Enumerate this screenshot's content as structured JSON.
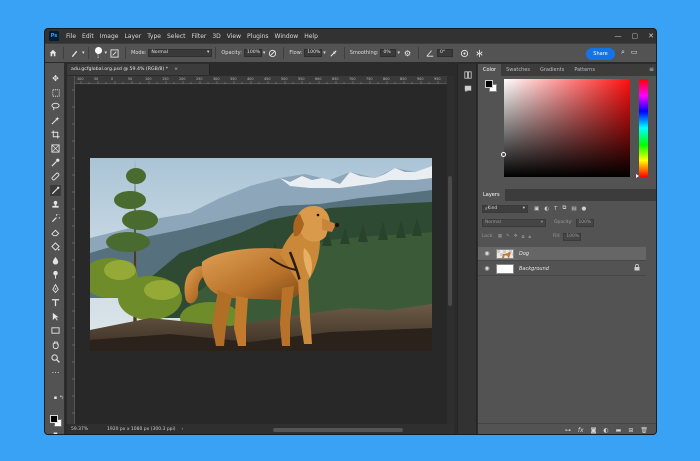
{
  "app": {
    "logo": "Ps",
    "menu": [
      "File",
      "Edit",
      "Image",
      "Layer",
      "Type",
      "Select",
      "Filter",
      "3D",
      "View",
      "Plugins",
      "Window",
      "Help"
    ],
    "window_controls": [
      "—",
      "▢",
      "✕"
    ]
  },
  "options": {
    "brush_size": "1",
    "mode_label": "Mode:",
    "mode_value": "Normal",
    "opacity_label": "Opacity:",
    "opacity_value": "100%",
    "flow_label": "Flow:",
    "flow_value": "100%",
    "smoothing_label": "Smoothing:",
    "smoothing_value": "0%",
    "angle_value": "0°",
    "share_label": "Share"
  },
  "document": {
    "tab_title": "adu.gcfglobal.org.psd @ 59.4% (RGB/8) *",
    "tab_close": "×",
    "ruler_top": [
      "100",
      "50",
      "0",
      "50",
      "100",
      "150",
      "200",
      "250",
      "300",
      "350",
      "400",
      "450",
      "500",
      "550",
      "600",
      "650",
      "700",
      "750",
      "800",
      "850",
      "900",
      "950",
      "1000",
      "1050",
      "1100",
      "1150",
      "1200",
      "1250",
      "1300",
      "1350",
      "1400",
      "1450",
      "1500",
      "1550",
      "1600",
      "1650",
      "1700",
      "1750",
      "1800",
      "1850",
      "1900",
      "1950",
      "2000",
      "2050"
    ],
    "zoom": "59.37%",
    "doc_size": "1920 px x 1080 px (300.3 ppi)",
    "status_arrow": "›"
  },
  "color_panel": {
    "tabs": [
      "Color",
      "Swatches",
      "Gradients",
      "Patterns"
    ],
    "active_tab": "Color",
    "colors": {
      "hue_top": "#ff0000",
      "foreground": "#000000",
      "background": "#ffffff"
    }
  },
  "layers_panel": {
    "tab": "Layers",
    "filter_label": "Kind",
    "blend_mode": "Normal",
    "opacity_label": "Opacity:",
    "opacity_value": "100%",
    "lock_label": "Lock:",
    "fill_label": "Fill:",
    "fill_value": "100%",
    "layers": [
      {
        "name": "Dog",
        "visible": true,
        "selected": true
      },
      {
        "name": "Background",
        "visible": true,
        "selected": false,
        "locked": true
      }
    ],
    "footer_icons": [
      "link-icon",
      "fx-icon",
      "mask-icon",
      "adjustment-icon",
      "group-icon",
      "new-layer-icon",
      "trash-icon"
    ]
  },
  "toolbar": {
    "tools": [
      "move-icon",
      "marquee-icon",
      "lasso-icon",
      "magic-wand-icon",
      "crop-icon",
      "frame-icon",
      "eyedropper-icon",
      "healing-icon",
      "brush-icon",
      "stamp-icon",
      "history-brush-icon",
      "eraser-icon",
      "bucket-icon",
      "blur-icon",
      "dodge-icon",
      "pen-icon",
      "type-icon",
      "path-select-icon",
      "rectangle-icon",
      "hand-icon",
      "zoom-icon",
      "more-icon"
    ],
    "active_tool": "brush-icon"
  }
}
